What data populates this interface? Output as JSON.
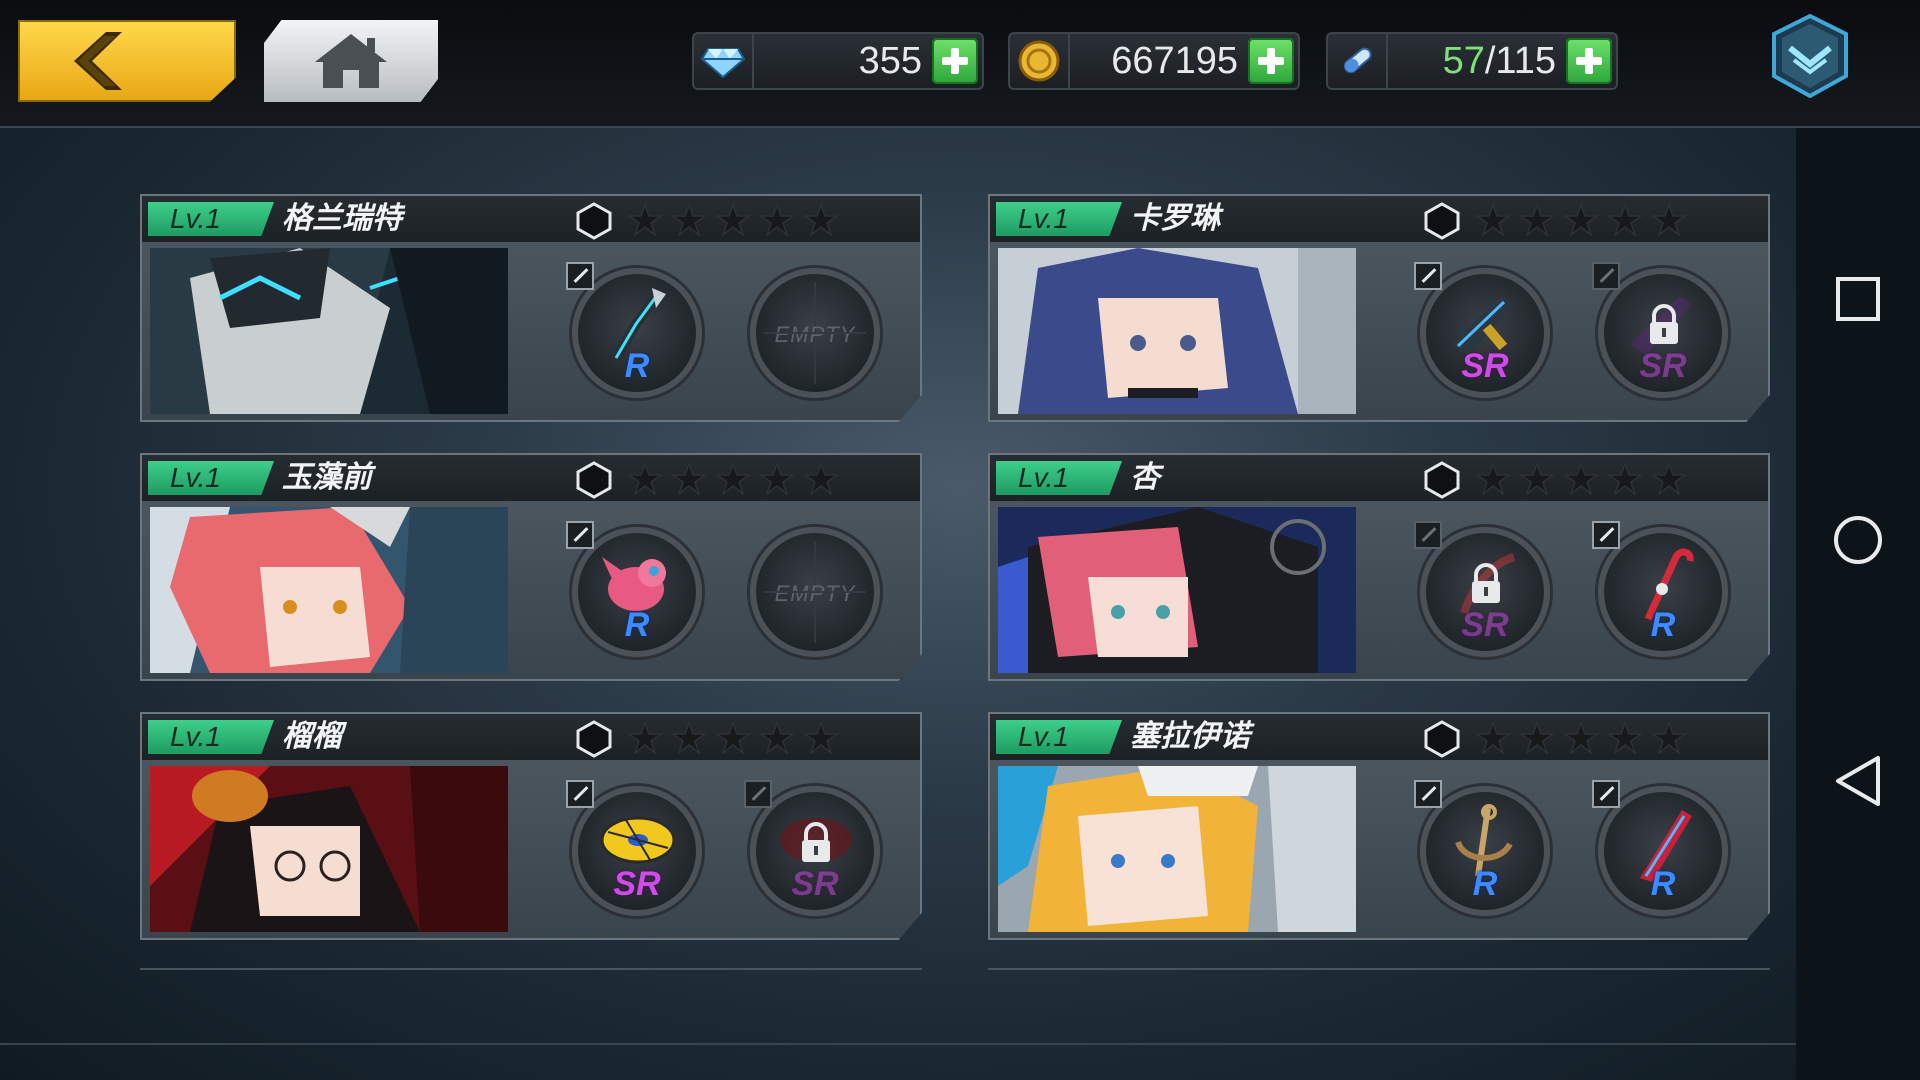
{
  "resources": {
    "gems": {
      "value": "355",
      "icon": "diamond-icon"
    },
    "gold": {
      "value": "667195",
      "icon": "gold-coin-icon"
    },
    "stamina": {
      "current": "57",
      "max": "/115",
      "icon": "stamina-vial-icon"
    }
  },
  "characters": [
    {
      "level": "Lv.1",
      "name": "格兰瑞特",
      "slot1": {
        "rarity": "R",
        "state": "equipped"
      },
      "slot2": {
        "state": "empty",
        "label": "EMPTY"
      }
    },
    {
      "level": "Lv.1",
      "name": "卡罗琳",
      "slot1": {
        "rarity": "SR",
        "state": "equipped"
      },
      "slot2": {
        "rarity": "SR",
        "state": "locked"
      }
    },
    {
      "level": "Lv.1",
      "name": "玉藻前",
      "slot1": {
        "rarity": "R",
        "state": "equipped"
      },
      "slot2": {
        "state": "empty",
        "label": "EMPTY"
      }
    },
    {
      "level": "Lv.1",
      "name": "杏",
      "slot1": {
        "rarity": "SR",
        "state": "locked"
      },
      "slot2": {
        "rarity": "R",
        "state": "equipped"
      }
    },
    {
      "level": "Lv.1",
      "name": "榴榴",
      "slot1": {
        "rarity": "SR",
        "state": "equipped"
      },
      "slot2": {
        "rarity": "SR",
        "state": "locked"
      }
    },
    {
      "level": "Lv.1",
      "name": "塞拉伊诺",
      "slot1": {
        "rarity": "R",
        "state": "equipped"
      },
      "slot2": {
        "rarity": "R",
        "state": "equipped"
      }
    }
  ],
  "colors": {
    "level_badge": "#2fb879",
    "rarity_r": "#3d8bff",
    "rarity_sr": "#d04ce8",
    "accent_yellow": "#f2c230",
    "plus_green": "#3fc24c"
  }
}
